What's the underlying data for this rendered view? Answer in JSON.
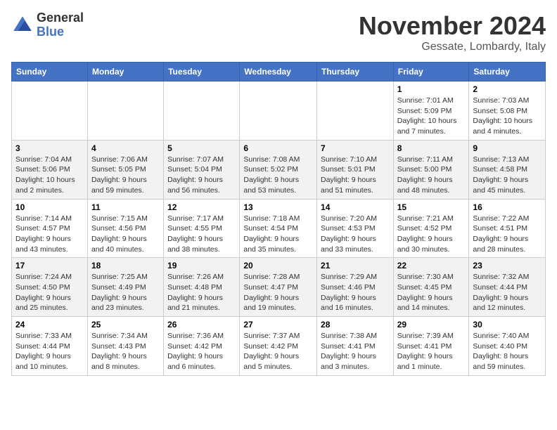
{
  "header": {
    "logo_general": "General",
    "logo_blue": "Blue",
    "month_title": "November 2024",
    "location": "Gessate, Lombardy, Italy"
  },
  "weekdays": [
    "Sunday",
    "Monday",
    "Tuesday",
    "Wednesday",
    "Thursday",
    "Friday",
    "Saturday"
  ],
  "weeks": [
    [
      {
        "day": "",
        "info": ""
      },
      {
        "day": "",
        "info": ""
      },
      {
        "day": "",
        "info": ""
      },
      {
        "day": "",
        "info": ""
      },
      {
        "day": "",
        "info": ""
      },
      {
        "day": "1",
        "info": "Sunrise: 7:01 AM\nSunset: 5:09 PM\nDaylight: 10 hours\nand 7 minutes."
      },
      {
        "day": "2",
        "info": "Sunrise: 7:03 AM\nSunset: 5:08 PM\nDaylight: 10 hours\nand 4 minutes."
      }
    ],
    [
      {
        "day": "3",
        "info": "Sunrise: 7:04 AM\nSunset: 5:06 PM\nDaylight: 10 hours\nand 2 minutes."
      },
      {
        "day": "4",
        "info": "Sunrise: 7:06 AM\nSunset: 5:05 PM\nDaylight: 9 hours\nand 59 minutes."
      },
      {
        "day": "5",
        "info": "Sunrise: 7:07 AM\nSunset: 5:04 PM\nDaylight: 9 hours\nand 56 minutes."
      },
      {
        "day": "6",
        "info": "Sunrise: 7:08 AM\nSunset: 5:02 PM\nDaylight: 9 hours\nand 53 minutes."
      },
      {
        "day": "7",
        "info": "Sunrise: 7:10 AM\nSunset: 5:01 PM\nDaylight: 9 hours\nand 51 minutes."
      },
      {
        "day": "8",
        "info": "Sunrise: 7:11 AM\nSunset: 5:00 PM\nDaylight: 9 hours\nand 48 minutes."
      },
      {
        "day": "9",
        "info": "Sunrise: 7:13 AM\nSunset: 4:58 PM\nDaylight: 9 hours\nand 45 minutes."
      }
    ],
    [
      {
        "day": "10",
        "info": "Sunrise: 7:14 AM\nSunset: 4:57 PM\nDaylight: 9 hours\nand 43 minutes."
      },
      {
        "day": "11",
        "info": "Sunrise: 7:15 AM\nSunset: 4:56 PM\nDaylight: 9 hours\nand 40 minutes."
      },
      {
        "day": "12",
        "info": "Sunrise: 7:17 AM\nSunset: 4:55 PM\nDaylight: 9 hours\nand 38 minutes."
      },
      {
        "day": "13",
        "info": "Sunrise: 7:18 AM\nSunset: 4:54 PM\nDaylight: 9 hours\nand 35 minutes."
      },
      {
        "day": "14",
        "info": "Sunrise: 7:20 AM\nSunset: 4:53 PM\nDaylight: 9 hours\nand 33 minutes."
      },
      {
        "day": "15",
        "info": "Sunrise: 7:21 AM\nSunset: 4:52 PM\nDaylight: 9 hours\nand 30 minutes."
      },
      {
        "day": "16",
        "info": "Sunrise: 7:22 AM\nSunset: 4:51 PM\nDaylight: 9 hours\nand 28 minutes."
      }
    ],
    [
      {
        "day": "17",
        "info": "Sunrise: 7:24 AM\nSunset: 4:50 PM\nDaylight: 9 hours\nand 25 minutes."
      },
      {
        "day": "18",
        "info": "Sunrise: 7:25 AM\nSunset: 4:49 PM\nDaylight: 9 hours\nand 23 minutes."
      },
      {
        "day": "19",
        "info": "Sunrise: 7:26 AM\nSunset: 4:48 PM\nDaylight: 9 hours\nand 21 minutes."
      },
      {
        "day": "20",
        "info": "Sunrise: 7:28 AM\nSunset: 4:47 PM\nDaylight: 9 hours\nand 19 minutes."
      },
      {
        "day": "21",
        "info": "Sunrise: 7:29 AM\nSunset: 4:46 PM\nDaylight: 9 hours\nand 16 minutes."
      },
      {
        "day": "22",
        "info": "Sunrise: 7:30 AM\nSunset: 4:45 PM\nDaylight: 9 hours\nand 14 minutes."
      },
      {
        "day": "23",
        "info": "Sunrise: 7:32 AM\nSunset: 4:44 PM\nDaylight: 9 hours\nand 12 minutes."
      }
    ],
    [
      {
        "day": "24",
        "info": "Sunrise: 7:33 AM\nSunset: 4:44 PM\nDaylight: 9 hours\nand 10 minutes."
      },
      {
        "day": "25",
        "info": "Sunrise: 7:34 AM\nSunset: 4:43 PM\nDaylight: 9 hours\nand 8 minutes."
      },
      {
        "day": "26",
        "info": "Sunrise: 7:36 AM\nSunset: 4:42 PM\nDaylight: 9 hours\nand 6 minutes."
      },
      {
        "day": "27",
        "info": "Sunrise: 7:37 AM\nSunset: 4:42 PM\nDaylight: 9 hours\nand 5 minutes."
      },
      {
        "day": "28",
        "info": "Sunrise: 7:38 AM\nSunset: 4:41 PM\nDaylight: 9 hours\nand 3 minutes."
      },
      {
        "day": "29",
        "info": "Sunrise: 7:39 AM\nSunset: 4:41 PM\nDaylight: 9 hours\nand 1 minute."
      },
      {
        "day": "30",
        "info": "Sunrise: 7:40 AM\nSunset: 4:40 PM\nDaylight: 8 hours\nand 59 minutes."
      }
    ]
  ]
}
